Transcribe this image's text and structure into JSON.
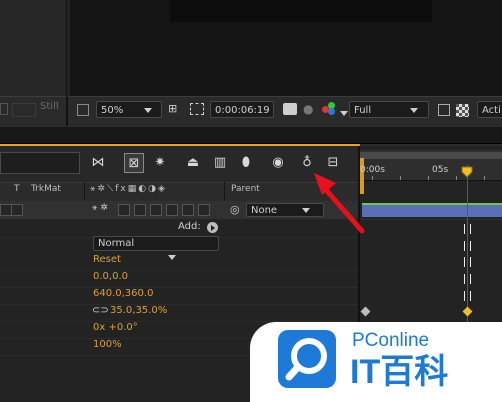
{
  "viewer_toolbar": {
    "still_label": "Still",
    "zoom": "50%",
    "timecode": "0:00:06:19",
    "resolution": "Full",
    "active_camera": "Acti"
  },
  "timeline": {
    "header": {
      "t_col": "T",
      "trkmat_col": "TrkMat",
      "parent_col": "Parent"
    },
    "layer": {
      "parent_value": "None"
    },
    "ruler": {
      "tick_0": "0:00s",
      "tick_5": "05s"
    },
    "properties": {
      "add_label": "Add:",
      "blend_mode": "Normal",
      "reset": "Reset",
      "anchor_point": "0.0,0.0",
      "position": "640.0,360.0",
      "scale": "35.0,35.0%",
      "rotation": "0x +0.0°",
      "opacity": "100%"
    }
  },
  "watermark": {
    "brand": "PConline",
    "cn_text": "IT百科"
  },
  "colors": {
    "accent_orange": "#f0a020",
    "value_orange": "#d9a03a",
    "playhead": "#e02020",
    "annotation_arrow": "#e8101c",
    "layer_bar": "#5a6fb7",
    "brand_blue": "#1e7ad8"
  }
}
